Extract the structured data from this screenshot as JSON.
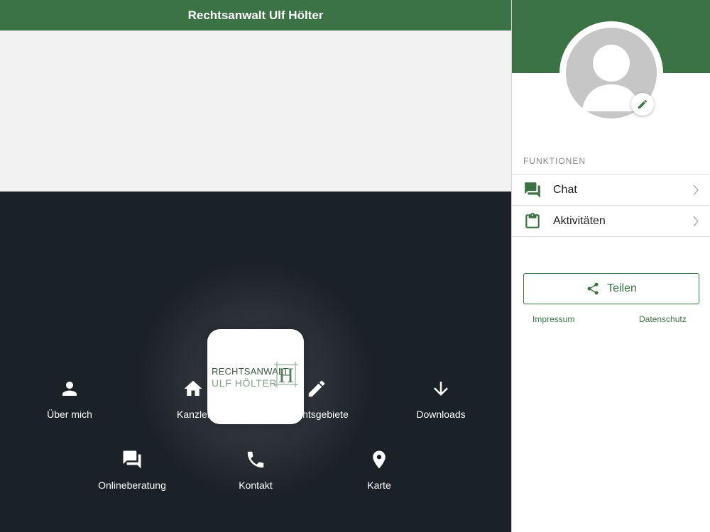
{
  "app": {
    "title": "Rechtsanwalt Ulf Hölter"
  },
  "logo": {
    "line1": "RECHTSANWALT",
    "line2": "ULF HÖLTER",
    "mark_letter": "H"
  },
  "nav": [
    {
      "label": "Über mich",
      "icon": "person-icon"
    },
    {
      "label": "Kanzlei",
      "icon": "home-icon"
    },
    {
      "label": "Rechtsgebiete",
      "icon": "pencil-icon"
    },
    {
      "label": "Downloads",
      "icon": "download-arrow-icon"
    },
    {
      "label": "Onlineberatung",
      "icon": "chat-bubbles-icon"
    },
    {
      "label": "Kontakt",
      "icon": "phone-icon"
    },
    {
      "label": "Karte",
      "icon": "map-pin-icon"
    }
  ],
  "sidebar": {
    "section_title": "FUNKTIONEN",
    "items": [
      {
        "label": "Chat",
        "icon": "chat-bubbles-icon"
      },
      {
        "label": "Aktivitäten",
        "icon": "clipboard-icon"
      }
    ],
    "share_label": "Teilen",
    "links": {
      "impressum": "Impressum",
      "datenschutz": "Datenschutz"
    }
  },
  "colors": {
    "brand_green": "#3b7344",
    "dark_background": "#1a2127",
    "banner_background": "#f2f2f2"
  }
}
